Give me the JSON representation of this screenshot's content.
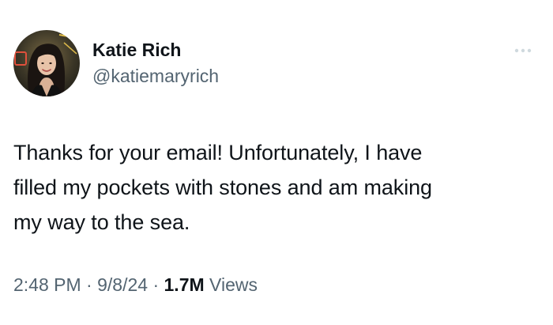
{
  "author": {
    "display_name": "Katie Rich",
    "handle": "@katiemaryrich"
  },
  "tweet": {
    "lines": [
      "Thanks for your email! Unfortunately, I have",
      "filled my pockets with stones and am making",
      "my way to the sea."
    ]
  },
  "meta": {
    "time": "2:48 PM",
    "separator": " · ",
    "date": "9/8/24",
    "views_count": "1.7M",
    "views_label": " Views"
  },
  "icons": {
    "more": "more-options-icon",
    "avatar": "profile-photo"
  },
  "colors": {
    "text_primary": "#0f1419",
    "text_secondary": "#536471",
    "background": "#ffffff"
  }
}
